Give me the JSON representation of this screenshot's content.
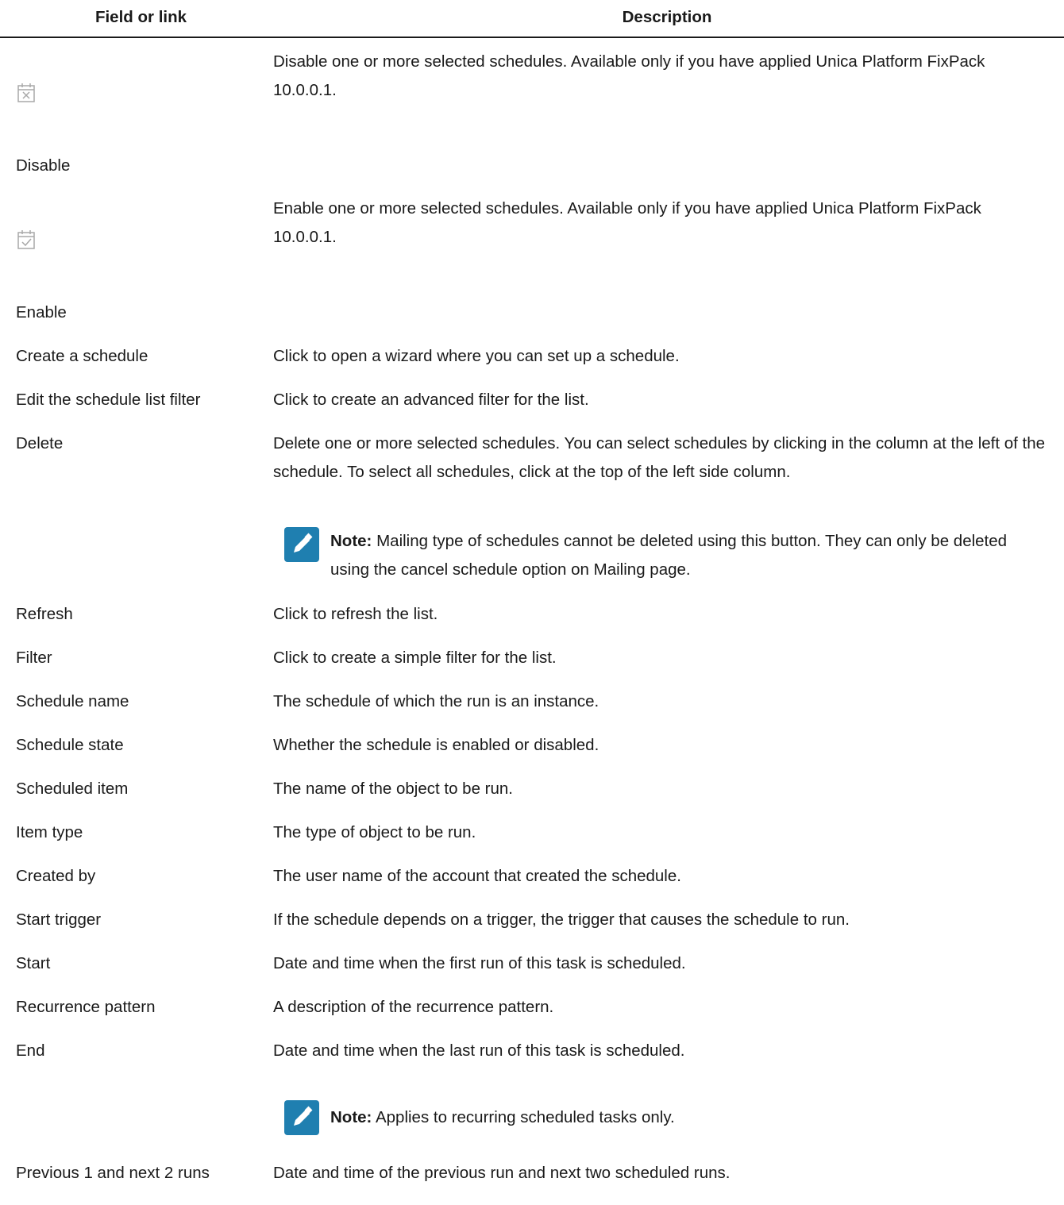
{
  "header": {
    "field_col": "Field or link",
    "desc_col": "Description"
  },
  "rows": [
    {
      "icon": "calendar-disable-icon",
      "field": "Disable",
      "desc": "Disable one or more selected schedules. Available only if you have applied Unica Platform FixPack 10.0.0.1."
    },
    {
      "icon": "calendar-enable-icon",
      "field": "Enable",
      "desc": "Enable one or more selected schedules. Available only if you have applied Unica Platform FixPack 10.0.0.1."
    },
    {
      "field": "Create a schedule",
      "desc": "Click to open a wizard where you can set up a schedule."
    },
    {
      "field": "Edit the schedule list filter",
      "desc": "Click to create an advanced filter for the list."
    },
    {
      "field": "Delete",
      "desc": "Delete one or more selected schedules. You can select schedules by clicking in the column at the left of the schedule. To select all schedules, click at the top of the left side column.",
      "note": {
        "label": "Note:",
        "text": "Mailing type of schedules cannot be deleted using this button. They can only be deleted using the cancel schedule option on Mailing page."
      }
    },
    {
      "field": "Refresh",
      "desc": "Click to refresh the list."
    },
    {
      "field": "Filter",
      "desc": "Click to create a simple filter for the list."
    },
    {
      "field": "Schedule name",
      "desc": "The schedule of which the run is an instance."
    },
    {
      "field": "Schedule state",
      "desc": "Whether the schedule is enabled or disabled."
    },
    {
      "field": "Scheduled item",
      "desc": "The name of the object to be run."
    },
    {
      "field": "Item type",
      "desc": "The type of object to be run."
    },
    {
      "field": "Created by",
      "desc": "The user name of the account that created the schedule."
    },
    {
      "field": "Start trigger",
      "desc": "If the schedule depends on a trigger, the trigger that causes the schedule to run."
    },
    {
      "field": "Start",
      "desc": "Date and time when the first run of this task is scheduled."
    },
    {
      "field": "Recurrence pattern",
      "desc": "A description of the recurrence pattern."
    },
    {
      "field": "End",
      "desc": "Date and time when the last run of this task is scheduled.",
      "note": {
        "label": "Note:",
        "text": "Applies to recurring scheduled tasks only."
      }
    },
    {
      "field": "Previous 1 and next 2 runs",
      "desc": "Date and time of the previous run and next two scheduled runs."
    }
  ],
  "colors": {
    "text": "#1a1a1a",
    "note_icon_bg": "#1f7fb0",
    "icon_gray": "#a8a8a8"
  }
}
